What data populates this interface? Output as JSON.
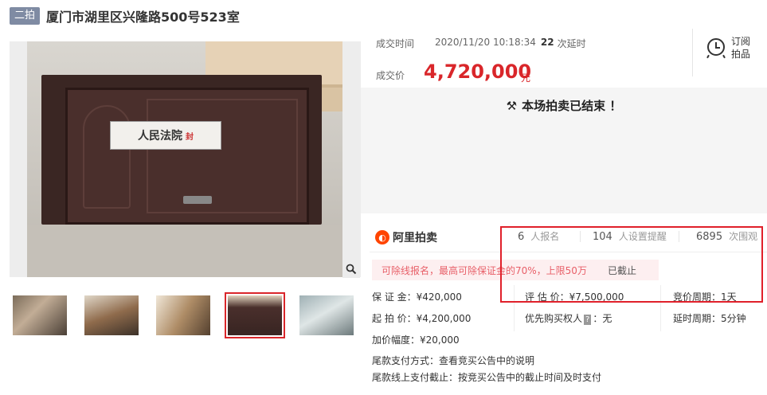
{
  "header": {
    "badge": "二拍",
    "title": "厦门市湖里区兴隆路500号523室"
  },
  "gallery": {
    "seal_text": "人民法院",
    "seal_sub": "封",
    "zoom_icon": "search-icon",
    "thumbnails": [
      {
        "label": "thumb-1",
        "active": false
      },
      {
        "label": "thumb-2",
        "active": false
      },
      {
        "label": "thumb-3",
        "active": false
      },
      {
        "label": "thumb-4",
        "active": true
      },
      {
        "label": "thumb-5",
        "active": false
      }
    ]
  },
  "deal": {
    "time_label": "成交时间",
    "time_value": "2020/11/20 10:18:34",
    "delay_count": "22",
    "delay_text": "次延时",
    "price_label": "成交价",
    "price_value": "4,720,000",
    "price_unit": "元"
  },
  "subscribe": {
    "label": "订阅拍品",
    "icon": "alarm-clock-icon"
  },
  "status": {
    "ended_text": "本场拍卖已结束 ！",
    "icon": "gavel-icon"
  },
  "platform": {
    "logo_text": "阿里拍卖"
  },
  "stats": {
    "registered_n": "6",
    "registered_label": "人报名",
    "reminder_n": "104",
    "reminder_label": "人设置提醒",
    "views_n": "6895",
    "views_label": "次围观"
  },
  "notice": {
    "text": "可除线报名，最高可除保证金的70%，上限50万",
    "status": "已截止"
  },
  "details": {
    "deposit_label": "保 证 金：",
    "deposit_value": "¥420,000",
    "appraisal_label": "评 估 价：",
    "appraisal_value": "¥7,500,000",
    "cycle_label": "竞价周期：",
    "cycle_value": "1天",
    "start_label": "起 拍 价：",
    "start_value": "¥4,200,000",
    "priority_label": "优先购买权人",
    "priority_tag": "?",
    "priority_value": "：无",
    "extend_label": "延时周期：",
    "extend_value": "5分钟",
    "increment_label": "加价幅度：",
    "increment_value": "¥20,000",
    "balance_label": "尾款支付方式：",
    "balance_value": "查看竞买公告中的说明",
    "balance_deadline_label": "尾款线上支付截止：",
    "balance_deadline_value": "按竞买公告中的截止时间及时支付"
  },
  "colors": {
    "accent_red": "#d9262a",
    "badge_grey": "#7f8ba3",
    "notice_bg": "#fdeff0",
    "logo_orange": "#ff4400"
  }
}
